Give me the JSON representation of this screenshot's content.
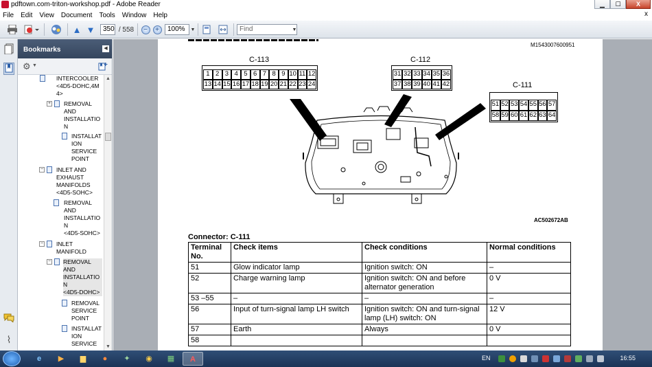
{
  "window": {
    "title": "pdftown.com-triton-workshop.pdf - Adobe Reader",
    "controls": {
      "minimize": "▁",
      "maximize": "☐",
      "close": "X"
    }
  },
  "menu": {
    "items": [
      "File",
      "Edit",
      "View",
      "Document",
      "Tools",
      "Window",
      "Help"
    ],
    "close_doc": "x"
  },
  "toolbar": {
    "page_current": "350",
    "page_total": "/ 558",
    "zoom": "100%",
    "find_placeholder": "Find"
  },
  "bookmarks": {
    "title": "Bookmarks",
    "rows": [
      {
        "text": "INTERCOOLER\n<4D5-DOHC,4M\n4>",
        "toggle": "−"
      },
      {
        "text": "REMOVAL\nAND\nINSTALLATIO\nN",
        "toggle": "+"
      },
      {
        "text": "INSTALLAT\nION\nSERVICE\nPOINT",
        "toggle": ""
      },
      {
        "text": "INLET AND\nEXHAUST\nMANIFOLDS\n<4D5-SOHC>",
        "toggle": "−"
      },
      {
        "text": "REMOVAL\nAND\nINSTALLATIO\nN\n<4D5-SOHC>",
        "toggle": ""
      },
      {
        "text": "INLET\nMANIFOLD",
        "toggle": "−"
      },
      {
        "text": "REMOVAL\nAND\nINSTALLATIO\nN\n<4D5-DOHC>",
        "toggle": "−",
        "highlight": true
      },
      {
        "text": "REMOVAL\nSERVICE\nPOINT",
        "toggle": ""
      },
      {
        "text": "INSTALLAT\nION\nSERVICE",
        "toggle": ""
      }
    ]
  },
  "document": {
    "figure_code": "M1543007600951",
    "figure_ref": "AC502672AB",
    "connectors": [
      {
        "name": "C-113",
        "rows": [
          [
            "1",
            "2",
            "3",
            "4",
            "5",
            "6",
            "7",
            "8",
            "9",
            "10",
            "11",
            "12"
          ],
          [
            "13",
            "14",
            "15",
            "16",
            "17",
            "18",
            "19",
            "20",
            "21",
            "22",
            "23",
            "24"
          ]
        ]
      },
      {
        "name": "C-112",
        "rows": [
          [
            "31",
            "32",
            "33",
            "34",
            "35",
            "36"
          ],
          [
            "37",
            "38",
            "39",
            "40",
            "41",
            "42"
          ]
        ]
      },
      {
        "name": "C-111",
        "rows": [
          [
            "51",
            "52",
            "53",
            "54",
            "55",
            "56",
            "57"
          ],
          [
            "58",
            "59",
            "60",
            "61",
            "62",
            "63",
            "64"
          ]
        ]
      }
    ],
    "connector_title": "Connector: C-111",
    "table": {
      "headers": [
        "Terminal No.",
        "Check items",
        "Check conditions",
        "Normal conditions"
      ],
      "rows": [
        [
          "51",
          "Glow indicator lamp",
          "Ignition switch: ON",
          "–"
        ],
        [
          "52",
          "Charge warning lamp",
          "Ignition switch: ON and before alternator generation",
          "0 V"
        ],
        [
          "53 –55",
          "–",
          "–",
          "–"
        ],
        [
          "56",
          "Input of turn-signal lamp LH switch",
          "Ignition switch: ON and turn-signal lamp (LH) switch: ON",
          "12 V"
        ],
        [
          "57",
          "Earth",
          "Always",
          "0 V"
        ],
        [
          "58",
          "",
          "",
          ""
        ]
      ]
    }
  },
  "taskbar": {
    "language": "EN",
    "clock": "16:55"
  }
}
